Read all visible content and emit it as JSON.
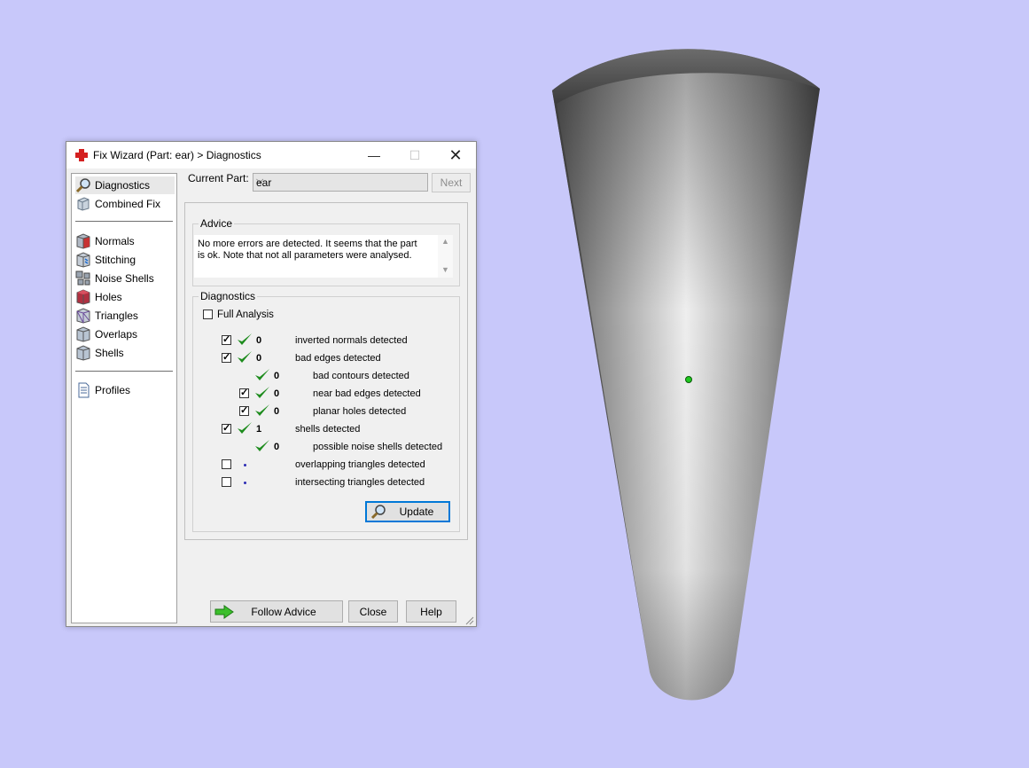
{
  "window": {
    "title": "Fix Wizard (Part: ear) > Diagnostics",
    "minimize": "—",
    "maximize": "☐",
    "close": "✕"
  },
  "nav": {
    "items": [
      {
        "label": "Diagnostics",
        "icon": "magnifier-icon"
      },
      {
        "label": "Combined Fix",
        "icon": "cube-icon"
      },
      {
        "label": "Normals",
        "icon": "normals-cube-icon"
      },
      {
        "label": "Stitching",
        "icon": "stitching-cube-icon"
      },
      {
        "label": "Noise Shells",
        "icon": "noise-shells-icon"
      },
      {
        "label": "Holes",
        "icon": "holes-cube-icon"
      },
      {
        "label": "Triangles",
        "icon": "triangles-cube-icon"
      },
      {
        "label": "Overlaps",
        "icon": "overlaps-cube-icon"
      },
      {
        "label": "Shells",
        "icon": "shells-cube-icon"
      },
      {
        "label": "Profiles",
        "icon": "document-icon"
      }
    ]
  },
  "current_part": {
    "label": "Current Part:",
    "value": "ear",
    "next": "Next"
  },
  "advice": {
    "legend": "Advice",
    "text": "No more errors are detected. It seems that the part is ok. Note that not all parameters were analysed."
  },
  "diagnostics": {
    "legend": "Diagnostics",
    "full_analysis": "Full Analysis",
    "rows": [
      {
        "count": "0",
        "label": "inverted normals detected"
      },
      {
        "count": "0",
        "label": "bad edges detected"
      },
      {
        "count": "0",
        "label": "bad contours detected"
      },
      {
        "count": "0",
        "label": "near bad edges detected"
      },
      {
        "count": "0",
        "label": "planar holes detected"
      },
      {
        "count": "1",
        "label": "shells detected"
      },
      {
        "count": "0",
        "label": "possible noise shells detected"
      },
      {
        "count": "",
        "label": "overlapping triangles detected"
      },
      {
        "count": "",
        "label": "intersecting triangles detected"
      }
    ],
    "update": "Update"
  },
  "buttons": {
    "follow_advice": "Follow Advice",
    "close": "Close",
    "help": "Help"
  },
  "colors": {
    "background": "#c8c8fa",
    "check": "#1e8c1e",
    "accent": "#0078d7"
  }
}
